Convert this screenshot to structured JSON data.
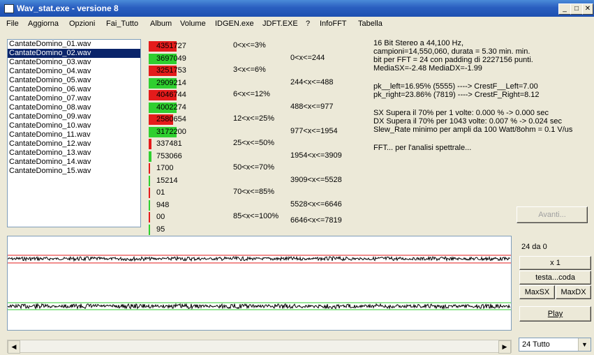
{
  "window": {
    "title": "Wav_stat.exe - versione 8"
  },
  "menu": [
    "File",
    "Aggiorna",
    "Opzioni",
    "Fai_Tutto",
    "Album",
    "Volume",
    "IDGEN.exe",
    "JDFT.EXE",
    "?",
    "InfoFFT",
    "Tabella"
  ],
  "files": {
    "items": [
      "CantateDomino_01.wav",
      "CantateDomino_02.wav",
      "CantateDomino_03.wav",
      "CantateDomino_04.wav",
      "CantateDomino_05.wav",
      "CantateDomino_06.wav",
      "CantateDomino_07.wav",
      "CantateDomino_08.wav",
      "CantateDomino_09.wav",
      "CantateDomino_10.wav",
      "CantateDomino_11.wav",
      "CantateDomino_12.wav",
      "CantateDomino_13.wav",
      "CantateDomino_14.wav",
      "CantateDomino_15.wav"
    ],
    "selected_index": 1
  },
  "bars": [
    {
      "value": "4351727",
      "color": "#e41b1b",
      "fill": 0.33
    },
    {
      "value": "3697049",
      "color": "#2fcf2f",
      "fill": 0.33
    },
    {
      "value": "3251753",
      "color": "#e41b1b",
      "fill": 0.33
    },
    {
      "value": "2909214",
      "color": "#2fcf2f",
      "fill": 0.33
    },
    {
      "value": "4046744",
      "color": "#e41b1b",
      "fill": 0.33
    },
    {
      "value": "4002274",
      "color": "#2fcf2f",
      "fill": 0.33
    },
    {
      "value": "2580654",
      "color": "#e41b1b",
      "fill": 0.29
    },
    {
      "value": "3172200",
      "color": "#2fcf2f",
      "fill": 0.33
    },
    {
      "value": "337481",
      "color": "#e41b1b",
      "fill": 0.03
    },
    {
      "value": "753066",
      "color": "#2fcf2f",
      "fill": 0.03
    },
    {
      "value": "1700",
      "color": "#e41b1b",
      "fill": 0.01
    },
    {
      "value": "15214",
      "color": "#2fcf2f",
      "fill": 0.01
    },
    {
      "value": "01",
      "color": "#e41b1b",
      "fill": 0.01
    },
    {
      "value": "948",
      "color": "#2fcf2f",
      "fill": 0.01
    },
    {
      "value": "00",
      "color": "#e41b1b",
      "fill": 0.01
    },
    {
      "value": "95",
      "color": "#2fcf2f",
      "fill": 0.01
    }
  ],
  "percent_ranges": [
    "0<x<=3%",
    "3<x<=6%",
    "6<x<=12%",
    "12<x<=25%",
    "25<x<=50%",
    "50<x<=70%",
    "70<x<=85%",
    "85<x<=100%"
  ],
  "freq_ranges": [
    "0<x<=244",
    "244<x<=488",
    "488<x<=977",
    "977<x<=1954",
    "1954<x<=3909",
    "3909<x<=5528",
    "5528<x<=6646",
    "6646<x<=7819"
  ],
  "info": {
    "line1": "16 Bit Stereo a 44,100 Hz,",
    "line2": "campioni=14,550,060, durata = 5.30 min. min.",
    "line3": "bit per FFT = 24 con padding di 2227156 punti.",
    "line4": "MediaSX=-2.48  MediaDX=-1.99",
    "line5": "pk__left=16.95% (5555) ----> CrestF__Left=7.00",
    "line6": "pk_right=23.86% (7819) ----> CrestF_Right=8.12",
    "line7": "SX Supera il 70% per 1 volte: 0.000 % -> 0.000 sec",
    "line8": "DX Supera il 70% per 1043 volte: 0.007 % -> 0.024 sec",
    "line9": "Slew_Rate minimo per ampli da 100 Watt/8ohm = 0.1 V/us",
    "line10": "FFT... per l'analisi spettrale..."
  },
  "buttons": {
    "avanti": "Avanti...",
    "x1": "x 1",
    "testa_coda": "testa...coda",
    "maxsx": "MaxSX",
    "maxdx": "MaxDX",
    "play": "Play"
  },
  "position_label": "24 da 0",
  "dropdown_value": "24 Tutto",
  "colors": {
    "red_bar": "#e41b1b",
    "green_bar": "#2fcf2f",
    "title_bar": "#2a5fc0",
    "selection": "#0a246a"
  }
}
